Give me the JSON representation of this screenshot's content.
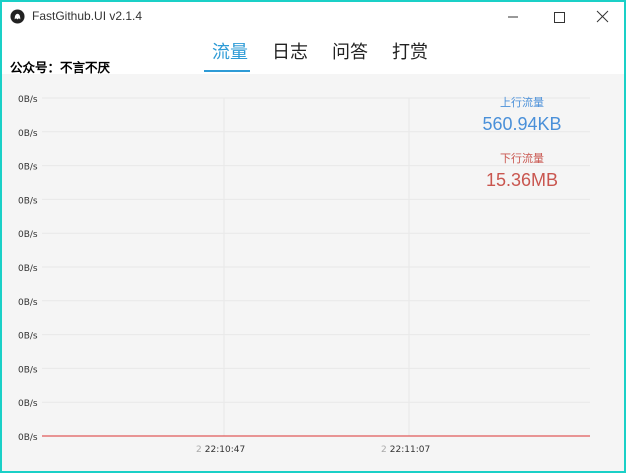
{
  "window": {
    "title": "FastGithub.UI v2.1.4"
  },
  "tabs": [
    {
      "label": "流量",
      "active": true
    },
    {
      "label": "日志",
      "active": false
    },
    {
      "label": "问答",
      "active": false
    },
    {
      "label": "打赏",
      "active": false
    }
  ],
  "watermark": "公众号：不言不厌",
  "stats": {
    "upload": {
      "label": "上行流量",
      "value": "560.94KB",
      "color": "#4a90d9"
    },
    "download": {
      "label": "下行流量",
      "value": "15.36MB",
      "color": "#c9564f"
    }
  },
  "colors": {
    "accent": "#2e9bd6",
    "border": "#1ad0c7",
    "series_line": "#e05a5a"
  },
  "chart_data": {
    "type": "line",
    "y_tick_labels": [
      "0B/s",
      "0B/s",
      "0B/s",
      "0B/s",
      "0B/s",
      "0B/s",
      "0B/s",
      "0B/s",
      "0B/s",
      "0B/s",
      "0B/s"
    ],
    "x_tick_labels": [
      "22:10:47",
      "22:11:07"
    ],
    "x_ghost_text": [
      "2",
      "2"
    ],
    "series": [
      {
        "values": [
          0,
          0,
          0,
          0,
          0,
          0
        ]
      }
    ],
    "grid": true
  }
}
